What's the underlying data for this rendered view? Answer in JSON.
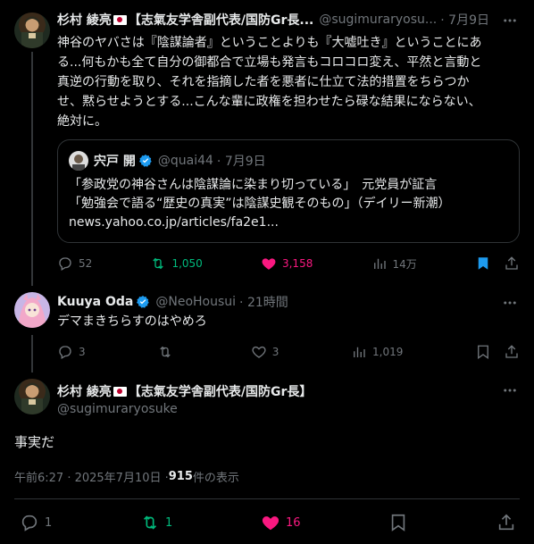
{
  "tweet1": {
    "author_name": "杉村 綾亮",
    "author_suffix": "【志氣友学舎副代表/国防Gr長...",
    "handle": "@sugimuraryosu...",
    "date": "· 7月9日",
    "lines": [
      "神谷のヤバさは『陰謀論者』ということよりも『大嘘吐き』ということにあ",
      "る...何もかも全て自分の御都合で立場も発言もコロコロ変え、平然と言動と",
      "真逆の行動を取り、それを指摘した者を悪者に仕立て法的措置をちらつか",
      "せ、黙らせようとする...こんな輩に政権を担わせたら碌な結果にならない、",
      "絶対に。"
    ],
    "quote": {
      "author_name": "宍戸 開",
      "handle": "@quai44",
      "date": "· 7月9日",
      "line1": "「参政党の神谷さんは陰謀論に染まり切っている」　元党員が証言",
      "line2": "「勉強会で語る“歴史の真実”は陰謀史観そのもの」（デイリー新潮）",
      "line3": "news.yahoo.co.jp/articles/fa2e1..."
    },
    "actions": {
      "replies": "52",
      "retweets": "1,050",
      "likes": "3,158",
      "views": "14万"
    }
  },
  "tweet2": {
    "author_name": "Kuuya Oda",
    "handle": "@NeoHousui",
    "date": "· 21時間",
    "text": "デマまきちらすのはやめろ",
    "actions": {
      "replies": "3",
      "retweets": "",
      "likes": "3",
      "views": "1,019"
    }
  },
  "main": {
    "author_name": "杉村 綾亮",
    "author_suffix": "【志氣友学舎副代表/国防Gr長】",
    "handle": "@sugimuraryosuke",
    "text": "事実だ",
    "meta_time": "午前6:27 · 2025年7月10日 · ",
    "meta_views": "915",
    "meta_views_label": " 件の表示",
    "actions": {
      "replies": "1",
      "retweets": "1",
      "likes": "16"
    }
  },
  "colors": {
    "green": "#00ba7c",
    "pink": "#f91880",
    "blue": "#1d9bf0",
    "muted": "#71767b"
  },
  "icons": [
    "more-icon",
    "reply-icon",
    "retweet-icon",
    "like-icon",
    "views-icon",
    "bookmark-icon",
    "share-icon",
    "verified-icon",
    "jp-flag-icon"
  ]
}
